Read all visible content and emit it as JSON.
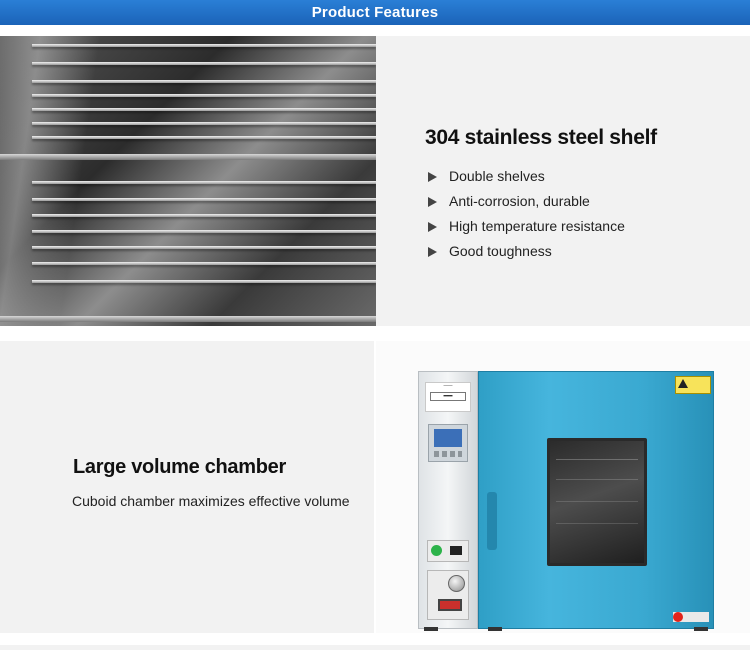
{
  "banner": {
    "title": "Product Features"
  },
  "section1": {
    "image": "stainless-steel-shelf-photo",
    "title": "304 stainless steel shelf",
    "features": [
      "Double shelves",
      "Anti-corrosion, durable",
      "High temperature resistance",
      "Good toughness"
    ]
  },
  "section2": {
    "image": "drying-oven-photo",
    "title": "Large volume chamber",
    "description": "Cuboid chamber maximizes effective volume"
  },
  "colors": {
    "banner": "#1f6fc4",
    "section_bg": "#f2f2f2",
    "oven_body": "#3aa9d1"
  }
}
